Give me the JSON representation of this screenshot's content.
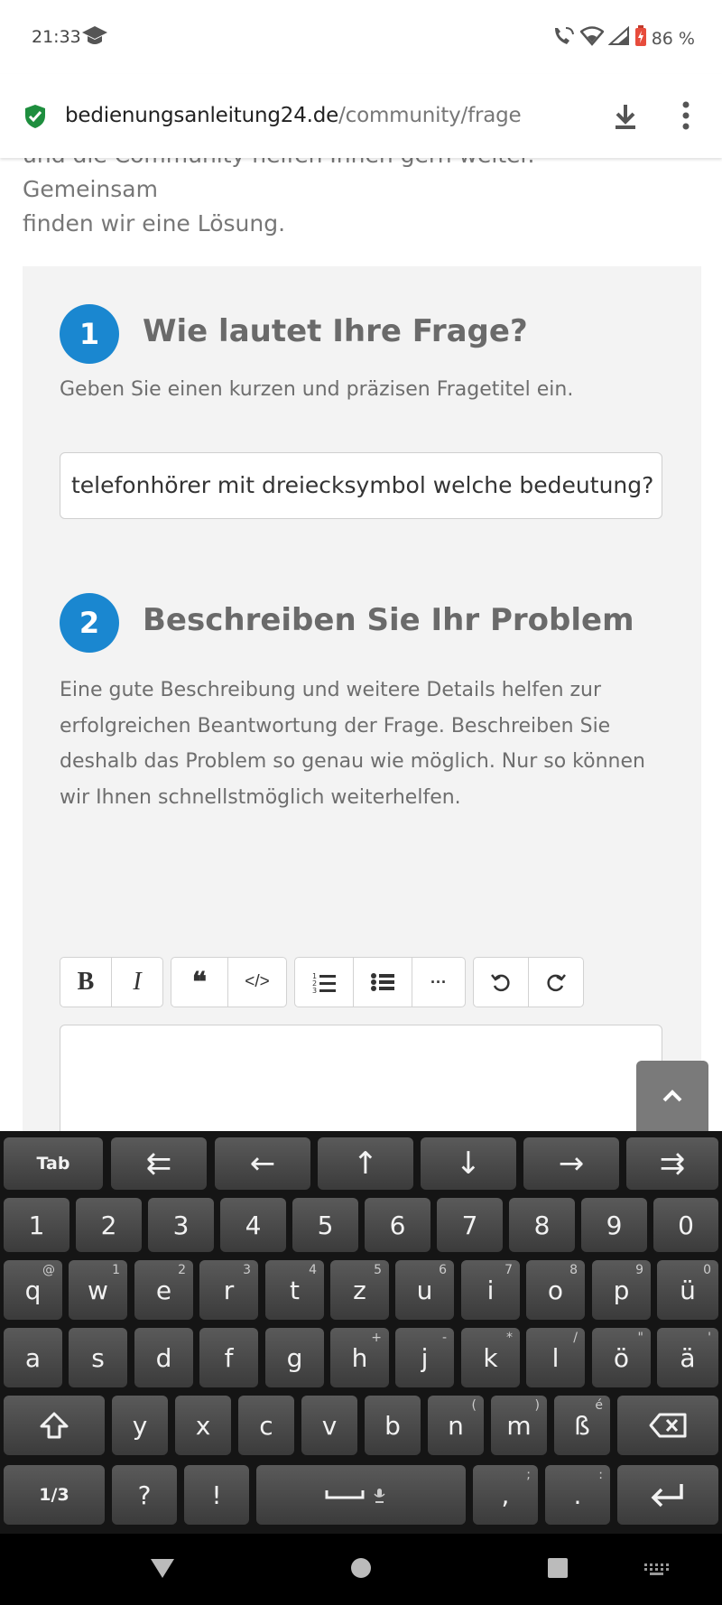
{
  "status_bar": {
    "time": "21:33",
    "battery": "86 %",
    "icons": [
      "graduation-cap-icon",
      "wifi-call-icon",
      "wifi-icon",
      "signal-icon",
      "battery-icon"
    ]
  },
  "browser": {
    "url_domain": "bedienungsanleitung24.de",
    "url_path": "/community/frage"
  },
  "page": {
    "intro_line1": "und die Community helfen Ihnen gern weiter. Gemeinsam",
    "intro_line2": "finden wir eine Lösung.",
    "step1": {
      "number": "1",
      "title": "Wie lautet Ihre Frage?",
      "hint": "Geben Sie einen kurzen und präzisen Fragetitel ein.",
      "input_value": "telefonhörer mit dreiecksymbol welche bedeutung?"
    },
    "step2": {
      "number": "2",
      "title": "Beschreiben Sie Ihr Problem",
      "desc_lines": [
        "Eine gute Beschreibung und weitere Details helfen zur",
        "erfolgreichen Beantwortung der Frage. Beschreiben Sie",
        "deshalb das Problem so genau wie möglich. Nur so können",
        "wir Ihnen schnellstmöglich weiterhelfen."
      ],
      "toolbar": {
        "bold": "B",
        "italic": "I",
        "quote": "❝",
        "code": "</>",
        "more": "···"
      },
      "editor_value": ""
    }
  },
  "keyboard": {
    "row_nav": [
      "Tab",
      "⇇",
      "←",
      "↑",
      "↓",
      "→",
      "⇉"
    ],
    "row_num": [
      "1",
      "2",
      "3",
      "4",
      "5",
      "6",
      "7",
      "8",
      "9",
      "0"
    ],
    "row1": [
      {
        "k": "q",
        "h": "@"
      },
      {
        "k": "w",
        "h": "1"
      },
      {
        "k": "e",
        "h": "2"
      },
      {
        "k": "r",
        "h": "3"
      },
      {
        "k": "t",
        "h": "4"
      },
      {
        "k": "z",
        "h": "5"
      },
      {
        "k": "u",
        "h": "6"
      },
      {
        "k": "i",
        "h": "7"
      },
      {
        "k": "o",
        "h": "8"
      },
      {
        "k": "p",
        "h": "9"
      },
      {
        "k": "ü",
        "h": "0"
      }
    ],
    "row2": [
      {
        "k": "a",
        "h": ""
      },
      {
        "k": "s",
        "h": ""
      },
      {
        "k": "d",
        "h": ""
      },
      {
        "k": "f",
        "h": ""
      },
      {
        "k": "g",
        "h": ""
      },
      {
        "k": "h",
        "h": "+"
      },
      {
        "k": "j",
        "h": "-"
      },
      {
        "k": "k",
        "h": "*"
      },
      {
        "k": "l",
        "h": "/"
      },
      {
        "k": "ö",
        "h": "\""
      },
      {
        "k": "ä",
        "h": "'"
      }
    ],
    "row3": [
      {
        "k": "y",
        "h": ""
      },
      {
        "k": "x",
        "h": ""
      },
      {
        "k": "c",
        "h": ""
      },
      {
        "k": "v",
        "h": ""
      },
      {
        "k": "b",
        "h": ""
      },
      {
        "k": "n",
        "h": "("
      },
      {
        "k": "m",
        "h": ")"
      },
      {
        "k": "ß",
        "h": "é"
      }
    ],
    "row4": {
      "symbols": "1/3",
      "question": "?",
      "exclaim": "!",
      "comma": ",",
      "comma_hint": ";",
      "period": ".",
      "period_hint": ":"
    }
  }
}
